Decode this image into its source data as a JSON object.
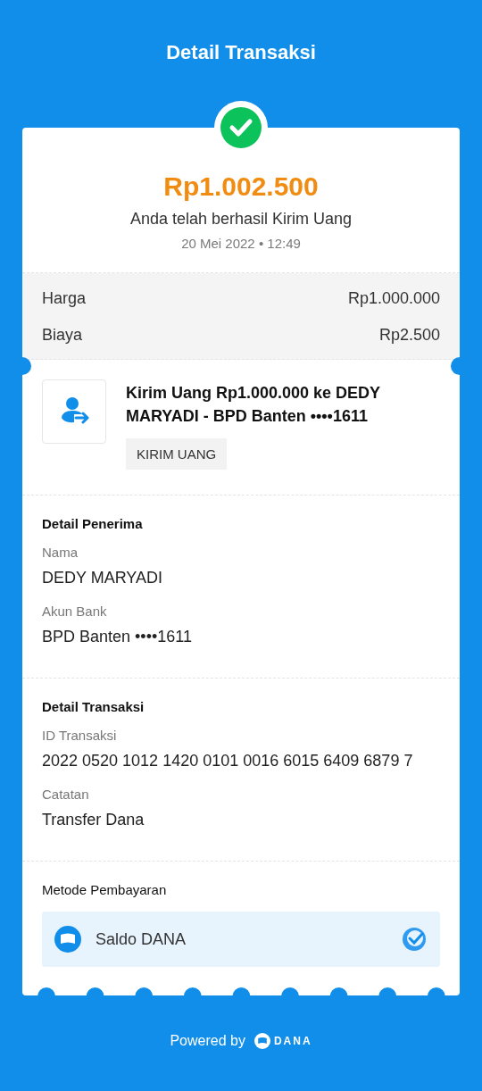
{
  "header": {
    "title": "Detail Transaksi"
  },
  "receipt": {
    "amount": "Rp1.002.500",
    "message": "Anda telah berhasil Kirim Uang",
    "datetime": "20 Mei 2022 • 12:49",
    "breakdown": [
      {
        "label": "Harga",
        "value": "Rp1.000.000"
      },
      {
        "label": "Biaya",
        "value": "Rp2.500"
      }
    ],
    "product": {
      "title": "Kirim Uang Rp1.000.000 ke DEDY MARYADI - BPD Banten ••••1611",
      "tag": "KIRIM UANG"
    },
    "sections": [
      {
        "title": "Detail Penerima",
        "fields": [
          {
            "label": "Nama",
            "value": "DEDY MARYADI"
          },
          {
            "label": "Akun Bank",
            "value": "BPD Banten ••••1611"
          }
        ]
      },
      {
        "title": "Detail Transaksi",
        "fields": [
          {
            "label": "ID Transaksi",
            "value": "2022 0520 1012 1420 0101 0016 6015 6409 6879 7"
          },
          {
            "label": "Catatan",
            "value": "Transfer Dana"
          }
        ]
      }
    ],
    "payment": {
      "title": "Metode Pembayaran",
      "methods": [
        {
          "name": "Saldo DANA",
          "selected": true
        }
      ]
    }
  },
  "footer": {
    "text": "Powered by",
    "brand": "DANA"
  }
}
